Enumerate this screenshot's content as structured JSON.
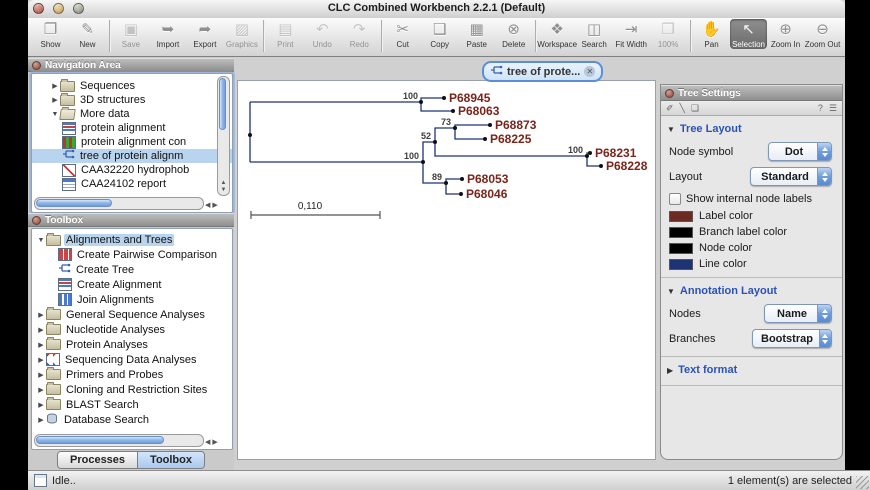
{
  "window": {
    "title": "CLC Combined Workbench 2.2.1 (Default)"
  },
  "toolbar": {
    "main": [
      {
        "label": "Show",
        "icon": "show-icon",
        "glyph": "❐",
        "disabled": false
      },
      {
        "label": "New",
        "icon": "new-icon",
        "glyph": "✎",
        "disabled": false
      },
      {
        "label": "Save",
        "icon": "save-icon",
        "glyph": "▣",
        "disabled": true
      },
      {
        "label": "Import",
        "icon": "import-icon",
        "glyph": "➥",
        "disabled": false
      },
      {
        "label": "Export",
        "icon": "export-icon",
        "glyph": "➦",
        "disabled": false
      },
      {
        "label": "Graphics",
        "icon": "graphics-icon",
        "glyph": "▨",
        "disabled": true
      },
      {
        "label": "Print",
        "icon": "print-icon",
        "glyph": "▤",
        "disabled": true
      },
      {
        "label": "Undo",
        "icon": "undo-icon",
        "glyph": "↶",
        "disabled": true
      },
      {
        "label": "Redo",
        "icon": "redo-icon",
        "glyph": "↷",
        "disabled": true
      },
      {
        "label": "Cut",
        "icon": "cut-icon",
        "glyph": "✂",
        "disabled": false
      },
      {
        "label": "Copy",
        "icon": "copy-icon",
        "glyph": "❑",
        "disabled": false
      },
      {
        "label": "Paste",
        "icon": "paste-icon",
        "glyph": "▦",
        "disabled": false
      },
      {
        "label": "Delete",
        "icon": "delete-icon",
        "glyph": "⊗",
        "disabled": false
      },
      {
        "label": "Workspace",
        "icon": "workspace-icon",
        "glyph": "❖",
        "disabled": false
      },
      {
        "label": "Search",
        "icon": "search-icon",
        "glyph": "◫",
        "disabled": false
      }
    ],
    "view": [
      {
        "label": "Fit Width",
        "icon": "fit-width-icon",
        "glyph": "⇥",
        "disabled": false,
        "selected": false
      },
      {
        "label": "100%",
        "icon": "zoom-100-icon",
        "glyph": "❒",
        "disabled": true,
        "selected": false
      },
      {
        "label": "Pan",
        "icon": "pan-hand-icon",
        "glyph": "✋",
        "disabled": false,
        "selected": false
      },
      {
        "label": "Selection",
        "icon": "selection-cursor-icon",
        "glyph": "↖",
        "disabled": false,
        "selected": true
      },
      {
        "label": "Zoom In",
        "icon": "zoom-in-icon",
        "glyph": "⊕",
        "disabled": false,
        "selected": false
      },
      {
        "label": "Zoom Out",
        "icon": "zoom-out-icon",
        "glyph": "⊖",
        "disabled": false,
        "selected": false
      }
    ]
  },
  "navigation": {
    "title": "Navigation Area",
    "items": [
      {
        "label": "Sequences",
        "icon": "folder-icon",
        "disclosure": "collapsed"
      },
      {
        "label": "3D structures",
        "icon": "folder-icon",
        "disclosure": "collapsed"
      },
      {
        "label": "More data",
        "icon": "open-folder-icon",
        "disclosure": "expanded"
      },
      {
        "label": "protein alignment",
        "icon": "alignment-icon"
      },
      {
        "label": "protein alignment con",
        "icon": "table-icon"
      },
      {
        "label": "tree of protein alignm",
        "icon": "tree-icon",
        "selected": true
      },
      {
        "label": "CAA32220 hydrophob",
        "icon": "chart-icon"
      },
      {
        "label": "CAA24102 report",
        "icon": "report-icon"
      }
    ]
  },
  "toolbox": {
    "title": "Toolbox",
    "items": [
      {
        "label": "Alignments and Trees",
        "icon": "trees-folder-icon",
        "disclosure": "expanded",
        "selected": true
      },
      {
        "label": "Create Pairwise Comparison",
        "icon": "pairwise-grid-icon"
      },
      {
        "label": "Create Tree",
        "icon": "tree-icon"
      },
      {
        "label": "Create Alignment",
        "icon": "alignment-icon"
      },
      {
        "label": "Join Alignments",
        "icon": "join-columns-icon"
      },
      {
        "label": "General Sequence Analyses",
        "icon": "folder-icon",
        "disclosure": "collapsed"
      },
      {
        "label": "Nucleotide Analyses",
        "icon": "folder-icon",
        "disclosure": "collapsed"
      },
      {
        "label": "Protein Analyses",
        "icon": "folder-icon",
        "disclosure": "collapsed"
      },
      {
        "label": "Sequencing Data Analyses",
        "icon": "trace-icon",
        "disclosure": "collapsed"
      },
      {
        "label": "Primers and Probes",
        "icon": "folder-icon",
        "disclosure": "collapsed"
      },
      {
        "label": "Cloning and Restriction Sites",
        "icon": "folder-icon",
        "disclosure": "collapsed"
      },
      {
        "label": "BLAST Search",
        "icon": "folder-icon",
        "disclosure": "collapsed"
      },
      {
        "label": "Database Search",
        "icon": "database-icon",
        "disclosure": "collapsed"
      }
    ],
    "tabs": [
      {
        "label": "Processes",
        "selected": false
      },
      {
        "label": "Toolbox",
        "selected": true
      }
    ]
  },
  "document": {
    "tab_label": "tree of prote...",
    "tab_icon": "tree-icon"
  },
  "tree": {
    "leaves": [
      "P68945",
      "P68063",
      "P68873",
      "P68225",
      "P68231",
      "P68228",
      "P68053",
      "P68046"
    ],
    "bootstraps": [
      "100",
      "73",
      "52",
      "100",
      "100",
      "89"
    ],
    "scale_label": "0,110",
    "line_color": "#1d3373",
    "label_color": "#7a241a"
  },
  "settings": {
    "title": "Tree Settings",
    "tools": {
      "help": "?"
    },
    "tree_layout": {
      "title": "Tree Layout",
      "node_symbol_label": "Node symbol",
      "node_symbol_value": "Dot",
      "layout_label": "Layout",
      "layout_value": "Standard",
      "checkbox_label": "Show internal node labels",
      "checkbox_checked": false,
      "colors": [
        {
          "label": "Label color",
          "hex": "#6b2a23"
        },
        {
          "label": "Branch label color",
          "hex": "#000000"
        },
        {
          "label": "Node color",
          "hex": "#000000"
        },
        {
          "label": "Line color",
          "hex": "#1d3373"
        }
      ]
    },
    "annotation_layout": {
      "title": "Annotation Layout",
      "nodes_label": "Nodes",
      "nodes_value": "Name",
      "branches_label": "Branches",
      "branches_value": "Bootstrap"
    },
    "text_format": {
      "title": "Text format"
    }
  },
  "statusbar": {
    "left": "Idle..",
    "right": "1 element(s) are selected"
  }
}
